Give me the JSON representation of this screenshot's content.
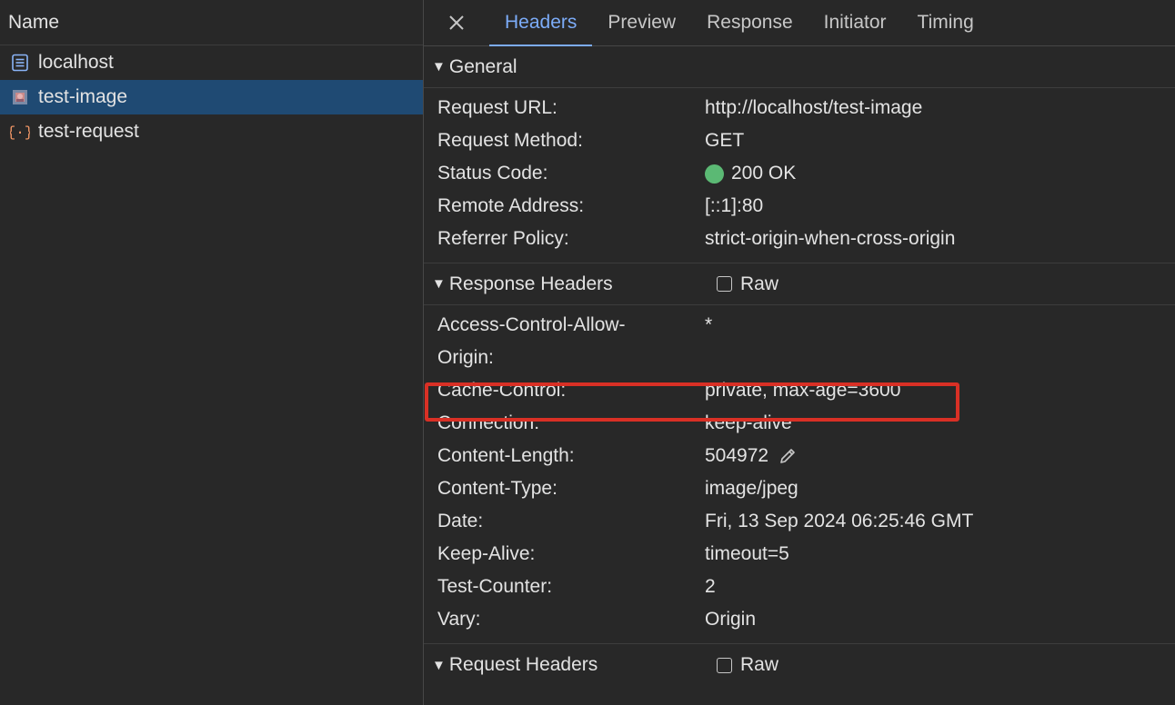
{
  "requests_panel": {
    "header": "Name",
    "items": [
      {
        "label": "localhost",
        "icon": "document-icon"
      },
      {
        "label": "test-image",
        "icon": "image-icon"
      },
      {
        "label": "test-request",
        "icon": "fetch-icon"
      }
    ],
    "selected_index": 1
  },
  "tabs": [
    "Headers",
    "Preview",
    "Response",
    "Initiator",
    "Timing"
  ],
  "active_tab": "Headers",
  "general": {
    "title": "General",
    "rows": [
      {
        "key": "Request URL:",
        "value": "http://localhost/test-image"
      },
      {
        "key": "Request Method:",
        "value": "GET"
      },
      {
        "key": "Status Code:",
        "value": "200 OK"
      },
      {
        "key": "Remote Address:",
        "value": "[::1]:80"
      },
      {
        "key": "Referrer Policy:",
        "value": "strict-origin-when-cross-origin"
      }
    ]
  },
  "response_headers": {
    "title": "Response Headers",
    "raw_label": "Raw",
    "rows": [
      {
        "key": "Access-Control-Allow-Origin:",
        "key_line1": "Access-Control-Allow-",
        "key_line2": "Origin:",
        "value": "*"
      },
      {
        "key": "Cache-Control:",
        "value": "private, max-age=3600"
      },
      {
        "key": "Connection:",
        "value": "keep-alive"
      },
      {
        "key": "Content-Length:",
        "value": "504972"
      },
      {
        "key": "Content-Type:",
        "value": "image/jpeg"
      },
      {
        "key": "Date:",
        "value": "Fri, 13 Sep 2024 06:25:46 GMT"
      },
      {
        "key": "Keep-Alive:",
        "value": "timeout=5"
      },
      {
        "key": "Test-Counter:",
        "value": "2"
      },
      {
        "key": "Vary:",
        "value": "Origin"
      }
    ]
  },
  "request_headers": {
    "title": "Request Headers",
    "raw_label": "Raw"
  },
  "colors": {
    "accent": "#7cacf8",
    "selected_row": "#1f4a73",
    "status_ok": "#5bb974",
    "highlight": "#d93025"
  }
}
